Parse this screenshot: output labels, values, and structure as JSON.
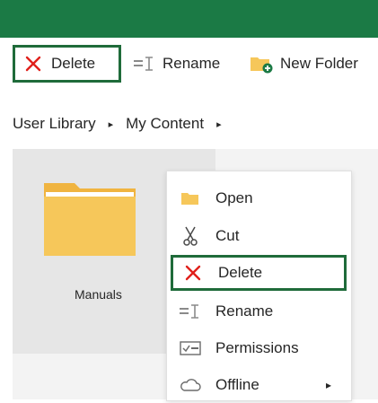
{
  "toolbar": {
    "delete_label": "Delete",
    "rename_label": "Rename",
    "new_folder_label": "New Folder"
  },
  "breadcrumb": {
    "items": [
      "User Library",
      "My Content"
    ],
    "separator": "▸"
  },
  "folder": {
    "name": "Manuals"
  },
  "context_menu": {
    "items": [
      {
        "label": "Open",
        "icon": "folder-open-icon"
      },
      {
        "label": "Cut",
        "icon": "scissors-icon"
      },
      {
        "label": "Delete",
        "icon": "delete-x-icon"
      },
      {
        "label": "Rename",
        "icon": "rename-icon"
      },
      {
        "label": "Permissions",
        "icon": "permissions-icon"
      },
      {
        "label": "Offline",
        "icon": "cloud-icon"
      }
    ]
  },
  "colors": {
    "header_green": "#1b7a45",
    "highlight_border": "#1f6b3a",
    "delete_red": "#e0201b",
    "folder_yellow": "#f6c75a"
  }
}
